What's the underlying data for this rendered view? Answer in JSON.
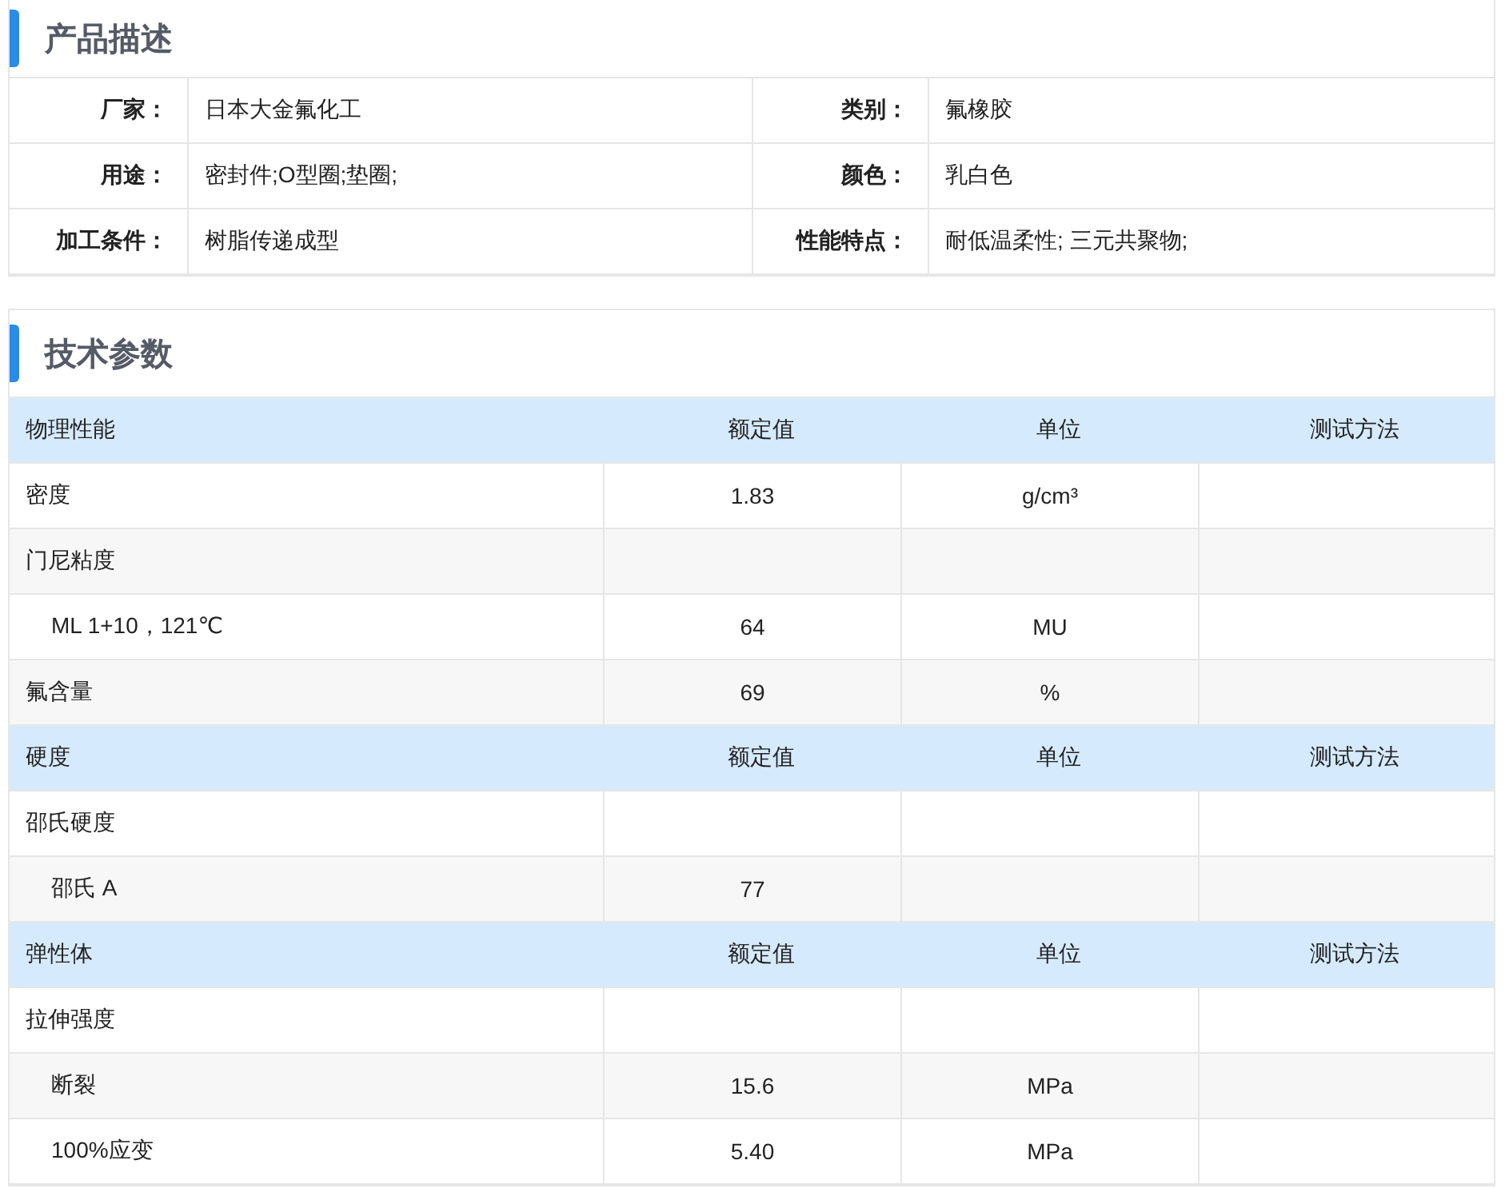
{
  "product_description": {
    "title": "产品描述",
    "rows": [
      [
        {
          "label": "厂家：",
          "value": "日本大金氟化工"
        },
        {
          "label": "类别：",
          "value": "氟橡胶"
        }
      ],
      [
        {
          "label": "用途：",
          "value": "密封件;O型圈;垫圈;"
        },
        {
          "label": "颜色：",
          "value": "乳白色"
        }
      ],
      [
        {
          "label": "加工条件：",
          "value": "树脂传递成型"
        },
        {
          "label": "性能特点：",
          "value": "耐低温柔性; 三元共聚物;"
        }
      ]
    ]
  },
  "technical_parameters": {
    "title": "技术参数",
    "groups": [
      {
        "header": [
          "物理性能",
          "额定值",
          "单位",
          "测试方法"
        ],
        "rows": [
          {
            "name": "密度",
            "value": "1.83",
            "unit": "g/cm³"
          },
          {
            "name": "门尼粘度",
            "children": [
              {
                "name": "ML 1+10，121℃",
                "value": "64",
                "unit": "MU"
              }
            ]
          },
          {
            "name": "氟含量",
            "value": "69",
            "unit": "%"
          }
        ]
      },
      {
        "header": [
          "硬度",
          "额定值",
          "单位",
          "测试方法"
        ],
        "rows": [
          {
            "name": "邵氏硬度",
            "children": [
              {
                "name": "邵氏 A",
                "value": "77"
              }
            ]
          }
        ]
      },
      {
        "header": [
          "弹性体",
          "额定值",
          "单位",
          "测试方法"
        ],
        "rows": [
          {
            "name": "拉伸强度",
            "children": [
              {
                "name": "断裂",
                "value": "15.6",
                "unit": "MPa"
              },
              {
                "name": "100%应变",
                "value": "5.40",
                "unit": "MPa"
              }
            ]
          }
        ]
      }
    ]
  }
}
